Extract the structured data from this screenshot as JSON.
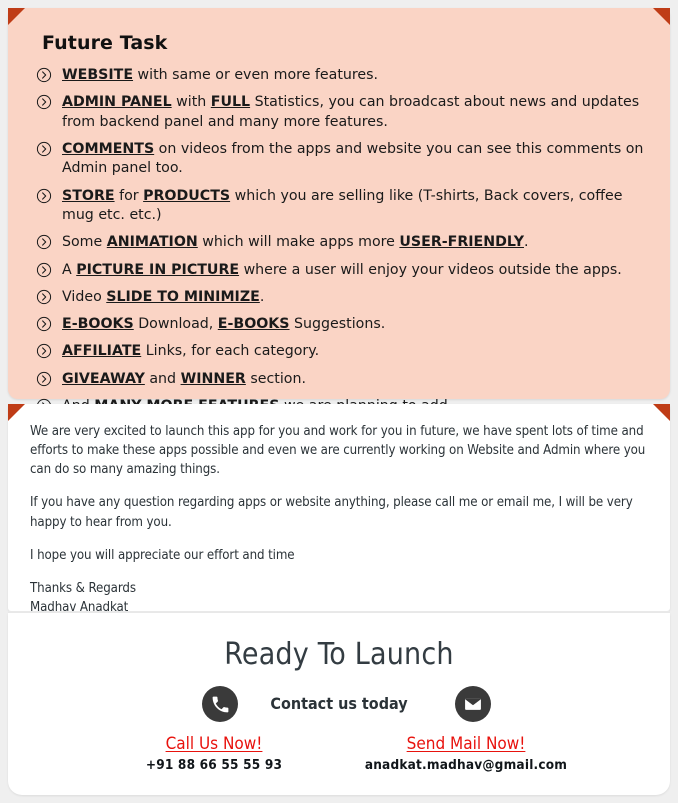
{
  "future_task": {
    "title": "Future Task",
    "bullet_icon": "chevron-right-circle-icon",
    "items": [
      {
        "id": "website",
        "html": "<b>WEBSITE</b> with same or even more features."
      },
      {
        "id": "admin-panel",
        "html": "<b>ADMIN PANEL</b> with <b>FULL</b> Statistics, you can broadcast about news and updates from backend panel and many more features."
      },
      {
        "id": "comments",
        "html": "<b>COMMENTS</b> on videos from the apps and website you can see this comments on Admin panel too."
      },
      {
        "id": "store",
        "html": "<b>STORE</b> for <b>PRODUCTS</b> which you are selling like (T-shirts, Back covers, coffee mug etc. etc.)"
      },
      {
        "id": "animation",
        "html": "Some <b>ANIMATION</b> which will make apps more <b>USER-FRIENDLY</b>."
      },
      {
        "id": "pip",
        "html": "A <b>PICTURE IN PICTURE</b> where a user will enjoy your videos outside the apps."
      },
      {
        "id": "slide",
        "html": "Video <b>SLIDE TO MINIMIZE</b>."
      },
      {
        "id": "ebooks",
        "html": "<b>E-BOOKS</b> Download, <b>E-BOOKS</b> Suggestions."
      },
      {
        "id": "affiliate",
        "html": "<b>AFFILIATE</b> Links, for each category."
      },
      {
        "id": "giveaway",
        "html": "<b>GIVEAWAY</b> and <b>WINNER</b> section."
      },
      {
        "id": "more",
        "html": "And <b>MANY MORE FEATURES</b> we are planning to add"
      }
    ]
  },
  "letter": {
    "paragraph_1": "We are very excited to launch this app for you and work for you in future, we have spent lots of time and efforts to make these apps possible and even we are currently working on Website and Admin where you can do so many amazing things.",
    "paragraph_2": "If you have any question regarding apps or website anything, please call me or email me, I will be very happy to hear from you.",
    "paragraph_3": "I hope you will appreciate our effort and time",
    "signoff": "Thanks & Regards",
    "signature_name": "Madhav Anadkat"
  },
  "footer": {
    "title": "Ready To Launch",
    "contact_heading": "Contact us today",
    "phone_icon": "phone-icon",
    "mail_icon": "envelope-icon",
    "call_link_label": "Call Us Now!",
    "phone_number": "+91 88 66 55 55 93",
    "mail_link_label": "Send Mail Now!",
    "email_address": "anadkat.madhav@gmail.com"
  },
  "colors": {
    "panel_pink": "#fad4c5",
    "corner_fold": "#bf3c16",
    "link_red": "#e8120d",
    "icon_badge": "#3a3a3a",
    "page_background": "#efefef",
    "heading_gray": "#333c42"
  }
}
